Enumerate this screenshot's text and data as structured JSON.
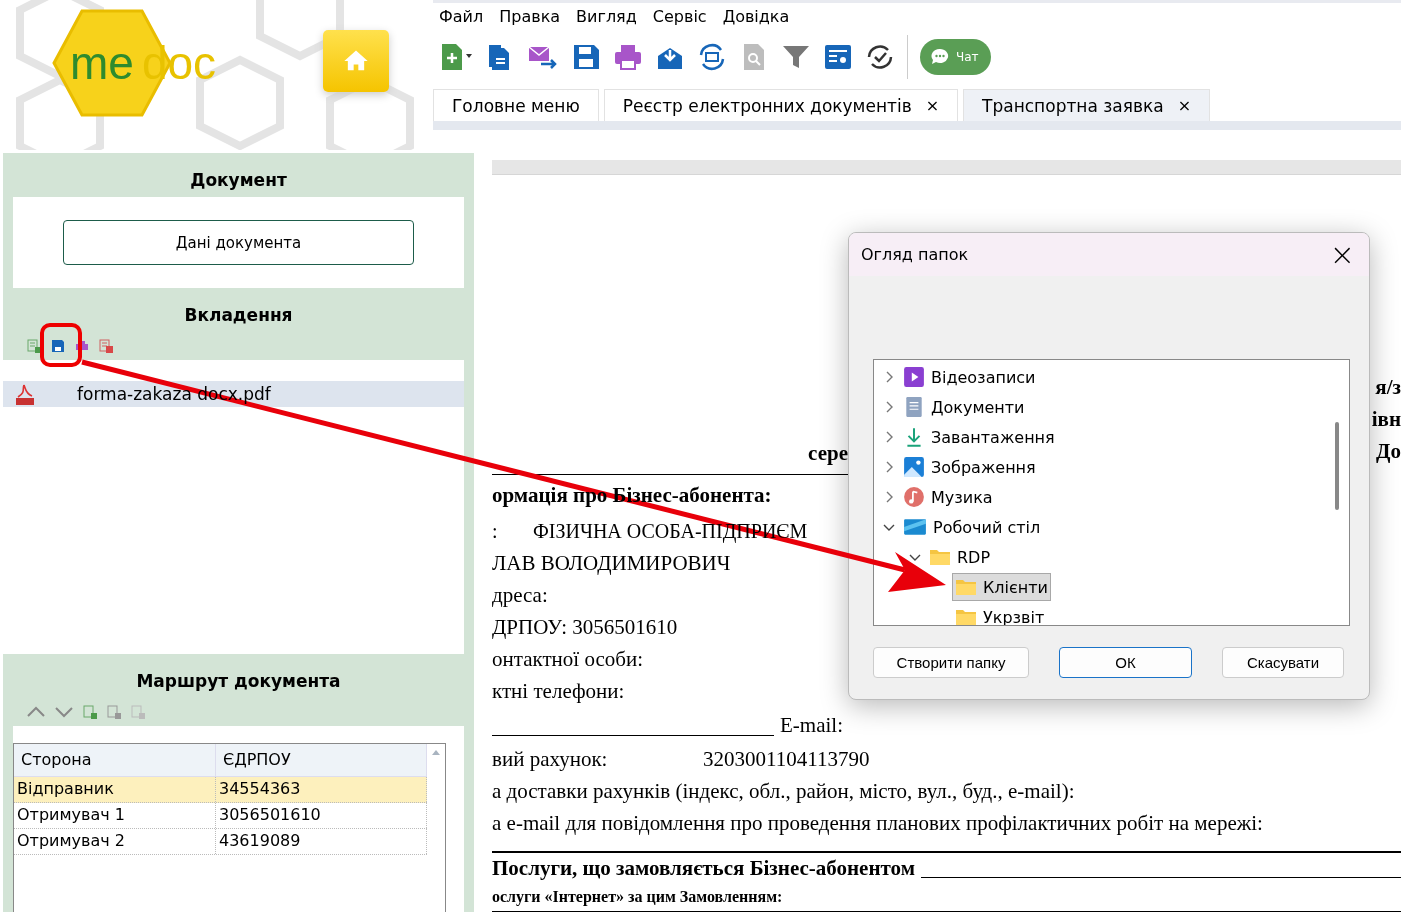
{
  "logo": {
    "part_1": "me",
    "part_2": "doc"
  },
  "menu": [
    "Файл",
    "Правка",
    "Вигляд",
    "Сервіс",
    "Довідка"
  ],
  "chat_button": {
    "label": "Чат"
  },
  "tabs": [
    {
      "label": "Головне меню",
      "selected": false
    },
    {
      "label": "Реєстр електронних документів",
      "close": "×",
      "selected": false
    },
    {
      "label": "Транспортна заявка",
      "close": "×",
      "selected": true
    }
  ],
  "document_panel": {
    "title": "Документ",
    "button": "Дані документа"
  },
  "attachments": {
    "title": "Вкладення",
    "files": [
      {
        "name": "forma-zakaza docx.pdf",
        "selected": true
      }
    ]
  },
  "route": {
    "title": "Маршрут документа",
    "columns": [
      "Сторона",
      "ЄДРПОУ"
    ],
    "rows": [
      {
        "cells": [
          "Відправник",
          "34554363"
        ],
        "selected": true
      },
      {
        "cells": [
          "Отримувач 1",
          "3056501610"
        ],
        "selected": false
      },
      {
        "cells": [
          "Отримувач 2",
          "43619089"
        ],
        "selected": false
      }
    ]
  },
  "document": {
    "right_fragments": [
      "я/з",
      "івн",
      "До"
    ],
    "underlined_fragment": "сере",
    "lines": [
      {
        "kind": "heading",
        "text": "ормація про Бізнес-абонента:"
      },
      {
        "kind": "field",
        "label": ":",
        "value": "ФІЗИЧНА ОСОБА-ПІДПРИЄМ"
      },
      {
        "kind": "plain",
        "text": "ЛАВ ВОЛОДИМИРОВИЧ"
      },
      {
        "kind": "plain",
        "text": "дреса:"
      },
      {
        "kind": "plain",
        "text": "ДРПОУ: 3056501610"
      },
      {
        "kind": "plain",
        "text": "онтактної особи:"
      },
      {
        "kind": "plain",
        "text": "ктні телефони:"
      },
      {
        "kind": "blank",
        "text": "E-mail:"
      },
      {
        "kind": "account",
        "label": "вий рахунок:",
        "value": "3203001104113790"
      },
      {
        "kind": "plain",
        "text": "а доставки рахунків (індекс, обл., район, місто, вул., буд., e-mail):"
      },
      {
        "kind": "plain",
        "text": "а e-mail для повідомлення  про проведення планових профілактичних робіт на мережі:"
      },
      {
        "kind": "section",
        "text": "Послуги, що замовляється Бізнес-абонентом"
      },
      {
        "kind": "subsection",
        "text": "ослуги «Інтернет» за цим Замовленням:"
      }
    ]
  },
  "dialog": {
    "title": "Огляд папок",
    "close": "×",
    "tree": [
      {
        "label": "Відеозаписи",
        "expanded": false,
        "selected": false
      },
      {
        "label": "Документи",
        "expanded": false,
        "selected": false
      },
      {
        "label": "Завантаження",
        "expanded": false,
        "selected": false
      },
      {
        "label": "Зображення",
        "expanded": false,
        "selected": false
      },
      {
        "label": "Музика",
        "expanded": false,
        "selected": false
      },
      {
        "label": "Робочий стіл",
        "expanded": true,
        "selected": false,
        "children": [
          {
            "label": "RDP",
            "expanded": true,
            "selected": false,
            "children": [
              {
                "label": "Клієнти",
                "selected": true
              },
              {
                "label": "Укрзвіт",
                "selected": false
              }
            ]
          }
        ]
      }
    ],
    "buttons": [
      {
        "label": "Створити папку",
        "default": false
      },
      {
        "label": "ОК",
        "default": true
      },
      {
        "label": "Скасувати",
        "default": false
      }
    ]
  }
}
